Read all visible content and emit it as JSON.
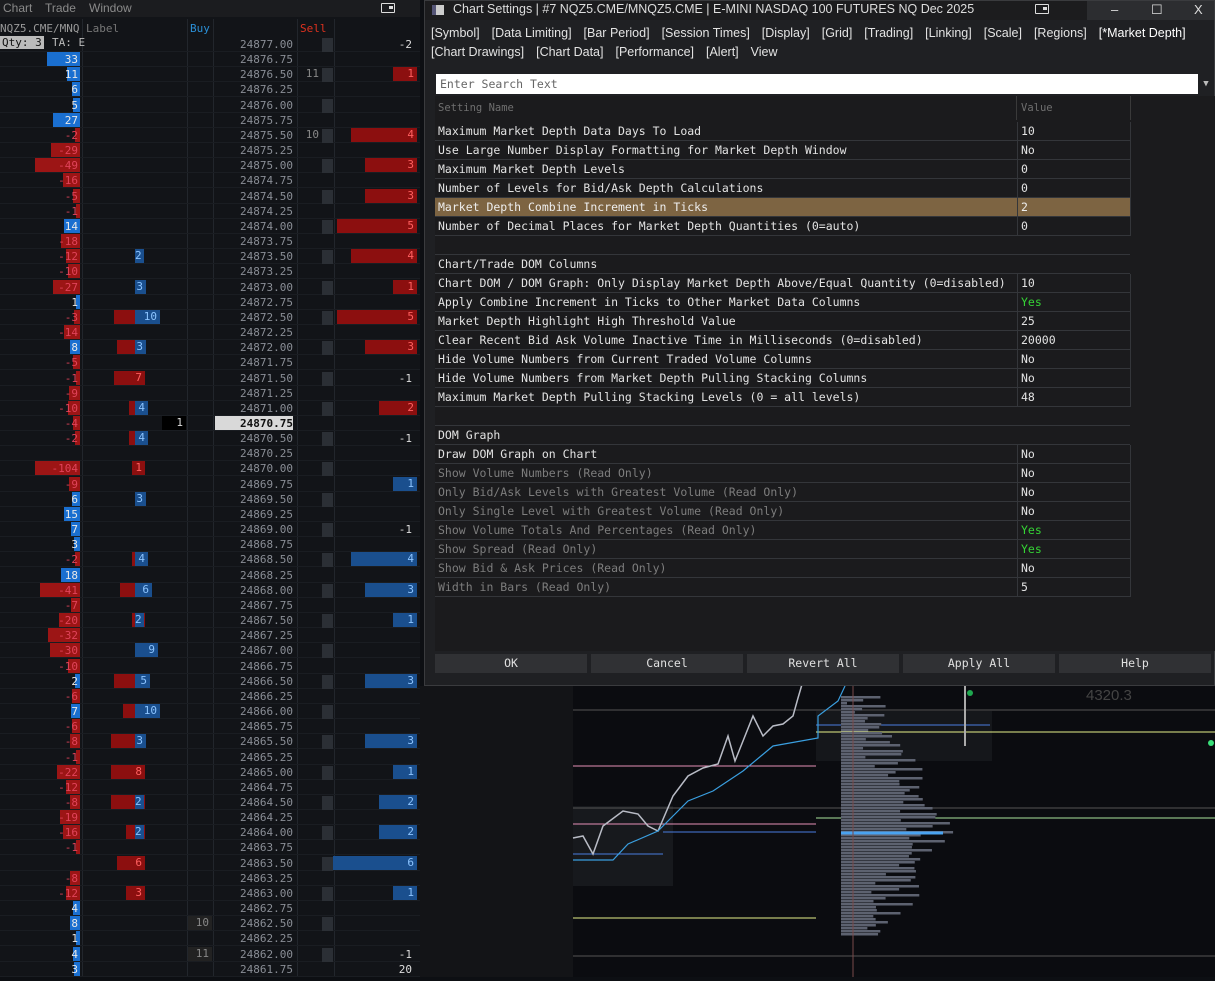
{
  "menu": {
    "items": [
      "Chart",
      "Trade",
      "Window"
    ]
  },
  "dom": {
    "symbol": "NQZ5.CME/MNQ",
    "label_header": "Label",
    "buy_header": "Buy",
    "sell_header": "Sell",
    "qty": "Qty: 3",
    "ta": "TA: E",
    "colors": {
      "buy": "#2a8fd6",
      "sell": "#e0321f",
      "bid_bar": "#1a6fd0",
      "ask_bar": "#8c0f0f"
    },
    "current_price": "24870.75",
    "rows": [
      {
        "p": "24877.00",
        "s": "-2"
      },
      {
        "p": "24876.75",
        "l": "33"
      },
      {
        "p": "24876.50",
        "l": "11",
        "sl": "11",
        "sr": "1",
        "sc": "r"
      },
      {
        "p": "24876.25",
        "l": "6"
      },
      {
        "p": "24876.00",
        "l": "5"
      },
      {
        "p": "24875.75",
        "l": "27"
      },
      {
        "p": "24875.50",
        "l": "-2",
        "sl": "10",
        "sr": "4",
        "sc": "r"
      },
      {
        "p": "24875.25",
        "l": "-29"
      },
      {
        "p": "24875.00",
        "l": "-49",
        "sr": "3",
        "sc": "r"
      },
      {
        "p": "24874.75",
        "l": "-16"
      },
      {
        "p": "24874.50",
        "l": "-5",
        "sr": "3",
        "sc": "r"
      },
      {
        "p": "24874.25",
        "l": "-1"
      },
      {
        "p": "24874.00",
        "l": "14",
        "sr": "5",
        "sc": "r"
      },
      {
        "p": "24873.75",
        "l": "-18"
      },
      {
        "p": "24873.50",
        "l": "-12",
        "lb": "2",
        "sr": "4",
        "sc": "r"
      },
      {
        "p": "24873.25",
        "l": "-10"
      },
      {
        "p": "24873.00",
        "l": "-27",
        "lb": "3",
        "sr": "1",
        "sc": "r"
      },
      {
        "p": "24872.75",
        "l": "1"
      },
      {
        "p": "24872.50",
        "l": "-3",
        "lr": "7",
        "lb": "10",
        "sr": "5",
        "sc": "r"
      },
      {
        "p": "24872.25",
        "l": "-14"
      },
      {
        "p": "24872.00",
        "l": "8",
        "lr": "6",
        "lb": "3",
        "sr": "3",
        "sc": "r"
      },
      {
        "p": "24871.75",
        "l": "-5"
      },
      {
        "p": "24871.50",
        "l": "-1",
        "lr": "7",
        "s": "-1"
      },
      {
        "p": "24871.25",
        "l": "-9"
      },
      {
        "p": "24871.00",
        "l": "-10",
        "lr": "2",
        "lb": "4",
        "sr": "2",
        "sc": "r"
      },
      {
        "p": "24870.75",
        "l": "-4",
        "b": "1"
      },
      {
        "p": "24870.50",
        "l": "-2",
        "lr": "2",
        "lb": "4",
        "s": "-1"
      },
      {
        "p": "24870.25"
      },
      {
        "p": "24870.00",
        "l": "-104",
        "lr": "1"
      },
      {
        "p": "24869.75",
        "l": "-9",
        "sr": "1",
        "sc": "b"
      },
      {
        "p": "24869.50",
        "l": "6",
        "lb": "3"
      },
      {
        "p": "24869.25",
        "l": "15"
      },
      {
        "p": "24869.00",
        "l": "7",
        "s": "-1"
      },
      {
        "p": "24868.75",
        "l": "3"
      },
      {
        "p": "24868.50",
        "l": "-2",
        "lr": "1",
        "lb": "4",
        "sr": "4",
        "sc": "b"
      },
      {
        "p": "24868.25",
        "l": "18"
      },
      {
        "p": "24868.00",
        "l": "-41",
        "lr": "5",
        "lb": "6",
        "sr": "3",
        "sc": "b"
      },
      {
        "p": "24867.75",
        "l": "-7"
      },
      {
        "p": "24867.50",
        "l": "-20",
        "lr": "1",
        "lb": "2",
        "sr": "1",
        "sc": "b"
      },
      {
        "p": "24867.25",
        "l": "-32"
      },
      {
        "p": "24867.00",
        "l": "-30",
        "lb": "9"
      },
      {
        "p": "24866.75",
        "l": "-10"
      },
      {
        "p": "24866.50",
        "l": "2",
        "lr": "7",
        "lb": "5",
        "sr": "3",
        "sc": "b"
      },
      {
        "p": "24866.25",
        "l": "-6"
      },
      {
        "p": "24866.00",
        "l": "7",
        "lr": "4",
        "lb": "10"
      },
      {
        "p": "24865.75",
        "l": "-6"
      },
      {
        "p": "24865.50",
        "l": "-8",
        "lr": "9",
        "lb": "3",
        "sr": "3",
        "sc": "b"
      },
      {
        "p": "24865.25",
        "l": "-1"
      },
      {
        "p": "24865.00",
        "l": "-22",
        "lr": "8",
        "sr": "1",
        "sc": "b"
      },
      {
        "p": "24864.75",
        "l": "-12"
      },
      {
        "p": "24864.50",
        "l": "-8",
        "lr": "8",
        "lb": "2",
        "sr": "2",
        "sc": "b"
      },
      {
        "p": "24864.25",
        "l": "-19"
      },
      {
        "p": "24864.00",
        "l": "-16",
        "lr": "3",
        "lb": "2",
        "sr": "2",
        "sc": "b"
      },
      {
        "p": "24863.75",
        "l": "-1"
      },
      {
        "p": "24863.50",
        "lr": "6",
        "sr": "6",
        "sc": "b"
      },
      {
        "p": "24863.25",
        "l": "-8"
      },
      {
        "p": "24863.00",
        "l": "-12",
        "lr": "3",
        "sr": "1",
        "sc": "b"
      },
      {
        "p": "24862.75",
        "l": "4"
      },
      {
        "p": "24862.50",
        "l": "8",
        "b": "10"
      },
      {
        "p": "24862.25",
        "l": "1"
      },
      {
        "p": "24862.00",
        "l": "4",
        "b": "11",
        "s": "-1"
      },
      {
        "p": "24861.75",
        "l": "3",
        "s": "20"
      }
    ]
  },
  "dialog": {
    "title": "Chart Settings | #7 NQZ5.CME/MNQZ5.CME | E-MINI NASDAQ 100 FUTURES NQ Dec 2025",
    "window_buttons": {
      "minimize": "–",
      "maximize": "☐",
      "close": "X"
    },
    "tabs": [
      "[Symbol]",
      "[Data Limiting]",
      "[Bar Period]",
      "[Session Times]",
      "[Display]",
      "[Grid]",
      "[Trading]",
      "[Linking]",
      "[Scale]",
      "[Regions]",
      "[*Market Depth]",
      "[Chart Drawings]",
      "[Chart Data]",
      "[Performance]",
      "[Alert]",
      "View"
    ],
    "search_placeholder": "Enter Search Text",
    "columns": {
      "name": "Setting Name",
      "value": "Value"
    },
    "value_yes_color": "#35d435",
    "rows": [
      {
        "name": "Maximum Market Depth Data Days To Load",
        "value": "10"
      },
      {
        "name": "Use Large Number Display Formatting for Market Depth Window",
        "value": "No"
      },
      {
        "name": "Maximum Market Depth Levels",
        "value": "0"
      },
      {
        "name": "Number of Levels for Bid/Ask Depth Calculations",
        "value": "0"
      },
      {
        "name": "Market Depth Combine Increment in Ticks",
        "value": "2",
        "highlight": true
      },
      {
        "name": "Number of Decimal Places for Market Depth Quantities (0=auto)",
        "value": "0"
      },
      {
        "blank": true
      },
      {
        "name": "Chart/Trade DOM Columns",
        "header": true
      },
      {
        "name": "Chart DOM / DOM Graph: Only Display Market Depth Above/Equal Quantity (0=disabled)",
        "value": "10"
      },
      {
        "name": "Apply Combine Increment in Ticks to Other Market Data Columns",
        "value": "Yes",
        "green": true
      },
      {
        "name": "Market Depth Highlight High Threshold Value",
        "value": "25"
      },
      {
        "name": "Clear Recent Bid Ask Volume Inactive Time in Milliseconds (0=disabled)",
        "value": "20000"
      },
      {
        "name": "Hide Volume Numbers from Current Traded Volume Columns",
        "value": "No"
      },
      {
        "name": "Hide Volume Numbers from Market Depth Pulling Stacking Columns",
        "value": "No"
      },
      {
        "name": "Maximum Market Depth Pulling Stacking Levels (0 = all levels)",
        "value": "48"
      },
      {
        "blank": true
      },
      {
        "name": "DOM Graph",
        "header": true
      },
      {
        "name": "Draw DOM Graph on Chart",
        "value": "No"
      },
      {
        "name": "Show Volume Numbers (Read Only)",
        "value": "No",
        "readonly": true
      },
      {
        "name": "Only Bid/Ask Levels with Greatest Volume (Read Only)",
        "value": "No",
        "readonly": true
      },
      {
        "name": "Only Single Level with Greatest Volume (Read Only)",
        "value": "No",
        "readonly": true
      },
      {
        "name": "Show Volume Totals And Percentages (Read Only)",
        "value": "Yes",
        "readonly": true,
        "green": true
      },
      {
        "name": "Show Spread (Read Only)",
        "value": "Yes",
        "readonly": true,
        "green": true
      },
      {
        "name": "Show Bid & Ask Prices (Read Only)",
        "value": "No",
        "readonly": true
      },
      {
        "name": "Width in Bars (Read Only)",
        "value": "5",
        "readonly": true
      }
    ],
    "buttons": {
      "ok": "OK",
      "cancel": "Cancel",
      "revert": "Revert All",
      "apply": "Apply All",
      "help": "Help"
    }
  },
  "chart": {
    "price_label": "4320.3"
  }
}
